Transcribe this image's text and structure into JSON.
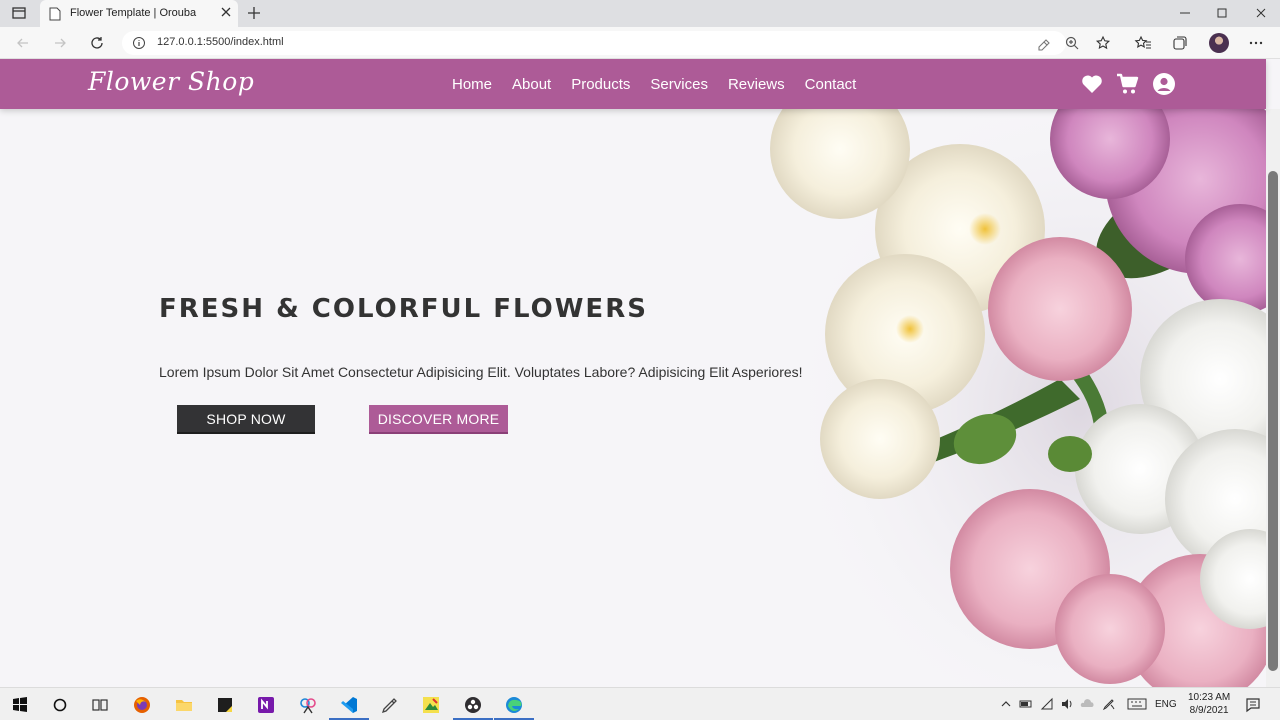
{
  "browser": {
    "tab_title": "Flower Template | Orouba",
    "url": "127.0.0.1:5500/index.html"
  },
  "site": {
    "logo": "Flower Shop",
    "nav": [
      "Home",
      "About",
      "Products",
      "Services",
      "Reviews",
      "Contact"
    ],
    "header_icons": [
      "heart-icon",
      "cart-icon",
      "user-icon"
    ],
    "hero": {
      "title": "FRESH & COLORFUL FLOWERS",
      "text": "Lorem Ipsum Dolor Sit Amet Consectetur Adipisicing Elit. Voluptates Labore? Adipisicing Elit Asperiores!",
      "shop_label": "SHOP NOW",
      "discover_label": "DISCOVER MORE"
    },
    "colors": {
      "brand": "#ad5b97",
      "dark": "#333335"
    }
  },
  "taskbar": {
    "lang": "ENG",
    "time": "10:23 AM",
    "date": "8/9/2021"
  }
}
